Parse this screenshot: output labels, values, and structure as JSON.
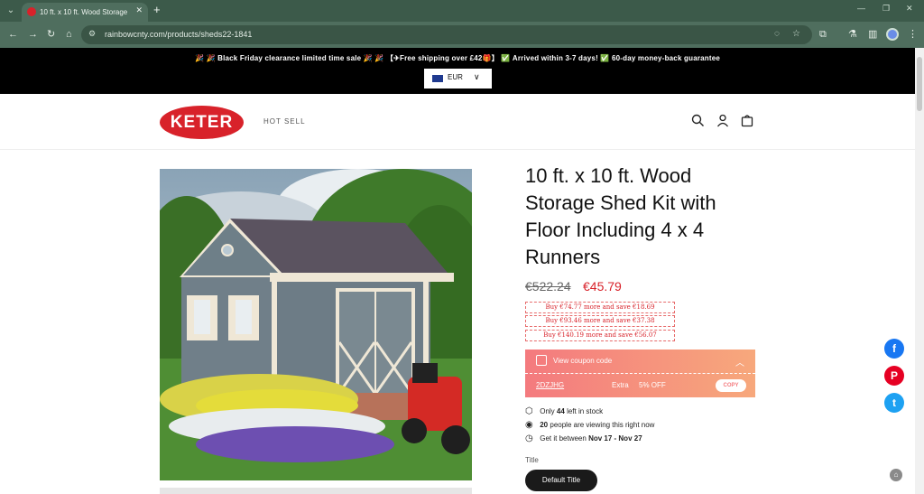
{
  "browser": {
    "tab_title": "10 ft. x 10 ft. Wood Storage Shed Kit",
    "tab_close": "✕",
    "new_tab": "+",
    "url": "rainbowcnty.com/products/sheds22-1841",
    "icons": [
      "back-icon",
      "forward-icon",
      "reload-icon",
      "home-icon",
      "site-info-icon",
      "eye-off-icon",
      "star-icon",
      "extensions-icon",
      "lab-icon",
      "side-panel-icon",
      "profile-icon",
      "menu-icon"
    ]
  },
  "announcement": {
    "text": "🎉 🎉 Black Friday clearance limited time sale 🎉 🎉 【✈Free shipping over £42🎁】 ✅ Arrived within 3-7 days! ✅ 60-day money-back guarantee",
    "currency": "EUR"
  },
  "header": {
    "logo": "KETER",
    "nav_hot_sell": "HOT SELL",
    "icons": [
      "search-icon",
      "account-icon",
      "cart-icon"
    ]
  },
  "product": {
    "title": "10 ft. x 10 ft. Wood Storage Shed Kit with Floor Including 4 x 4 Runners",
    "old_price": "€522.24",
    "sale_price": "€45.79",
    "tiers": [
      "Buy €74.77 more and save €18.69",
      "Buy €93.46 more and save €37.38",
      "Buy €140.19 more and save €56.07"
    ],
    "coupon": {
      "label": "View coupon code",
      "code": "2DZJHG",
      "extra": "Extra",
      "off": "5% OFF",
      "copy": "COPY"
    },
    "stock_prefix": "Only",
    "stock_count": "44",
    "stock_suffix": "left in stock",
    "viewers_count": "20",
    "viewers_suffix": "people are viewing this right now",
    "delivery_prefix": "Get it between",
    "delivery_range": "Nov 17 - Nov 27",
    "option_label": "Title",
    "option_value": "Default Title"
  },
  "social": {
    "facebook": "f",
    "pinterest": "P",
    "twitter": "t"
  },
  "colors": {
    "brand_red": "#d8222a",
    "chrome_green": "#4f6e5e",
    "coupon_start": "#f47a7e",
    "coupon_end": "#f7a87c"
  }
}
